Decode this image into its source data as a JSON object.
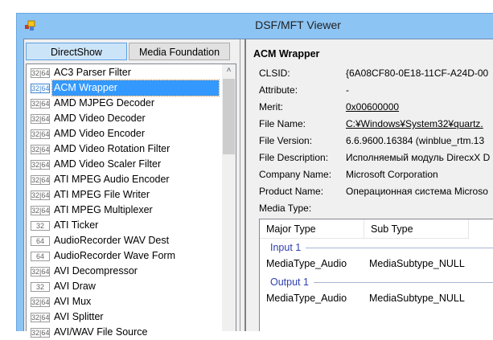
{
  "window": {
    "title": "DSF/MFT Viewer"
  },
  "tabs": [
    {
      "label": "DirectShow",
      "active": true
    },
    {
      "label": "Media Foundation",
      "active": false
    }
  ],
  "filters": [
    {
      "badge": "32|64",
      "name": "AC3 Parser Filter"
    },
    {
      "badge": "32|64",
      "name": "ACM Wrapper",
      "selected": true
    },
    {
      "badge": "32|64",
      "name": "AMD MJPEG Decoder"
    },
    {
      "badge": "32|64",
      "name": "AMD Video Decoder"
    },
    {
      "badge": "32|64",
      "name": "AMD Video Encoder"
    },
    {
      "badge": "32|64",
      "name": "AMD Video Rotation Filter"
    },
    {
      "badge": "32|64",
      "name": "AMD Video Scaler Filter"
    },
    {
      "badge": "32|64",
      "name": "ATI MPEG Audio Encoder"
    },
    {
      "badge": "32|64",
      "name": "ATI MPEG File Writer"
    },
    {
      "badge": "32|64",
      "name": "ATI MPEG Multiplexer"
    },
    {
      "badge": "32",
      "name": "ATI Ticker"
    },
    {
      "badge": "64",
      "name": "AudioRecorder WAV Dest"
    },
    {
      "badge": "64",
      "name": "AudioRecorder Wave Form"
    },
    {
      "badge": "32|64",
      "name": "AVI Decompressor"
    },
    {
      "badge": "32",
      "name": "AVI Draw"
    },
    {
      "badge": "32|64",
      "name": "AVI Mux"
    },
    {
      "badge": "32|64",
      "name": "AVI Splitter"
    },
    {
      "badge": "32|64",
      "name": "AVI/WAV File Source"
    }
  ],
  "details": {
    "title": "ACM Wrapper",
    "props": [
      {
        "label": "CLSID:",
        "value": "{6A08CF80-0E18-11CF-A24D-00"
      },
      {
        "label": "Attribute:",
        "value": "-"
      },
      {
        "label": "Merit:",
        "value": "0x00600000",
        "link": true
      },
      {
        "label": "File Name:",
        "value": "C:¥Windows¥System32¥quartz.",
        "link": true
      },
      {
        "label": "File Version:",
        "value": "6.6.9600.16384 (winblue_rtm.13"
      },
      {
        "label": "File Description:",
        "value": "Исполняемый модуль DirecxX D"
      },
      {
        "label": "Company Name:",
        "value": "Microsoft Corporation"
      },
      {
        "label": "Product Name:",
        "value": "Операционная система Microso"
      },
      {
        "label": "Media Type:",
        "value": ""
      }
    ],
    "media_table": {
      "columns": [
        "Major Type",
        "Sub Type"
      ],
      "groups": [
        {
          "name": "Input 1",
          "rows": [
            [
              "MediaType_Audio",
              "MediaSubtype_NULL"
            ]
          ]
        },
        {
          "name": "Output 1",
          "rows": [
            [
              "MediaType_Audio",
              "MediaSubtype_NULL"
            ]
          ]
        }
      ]
    }
  }
}
